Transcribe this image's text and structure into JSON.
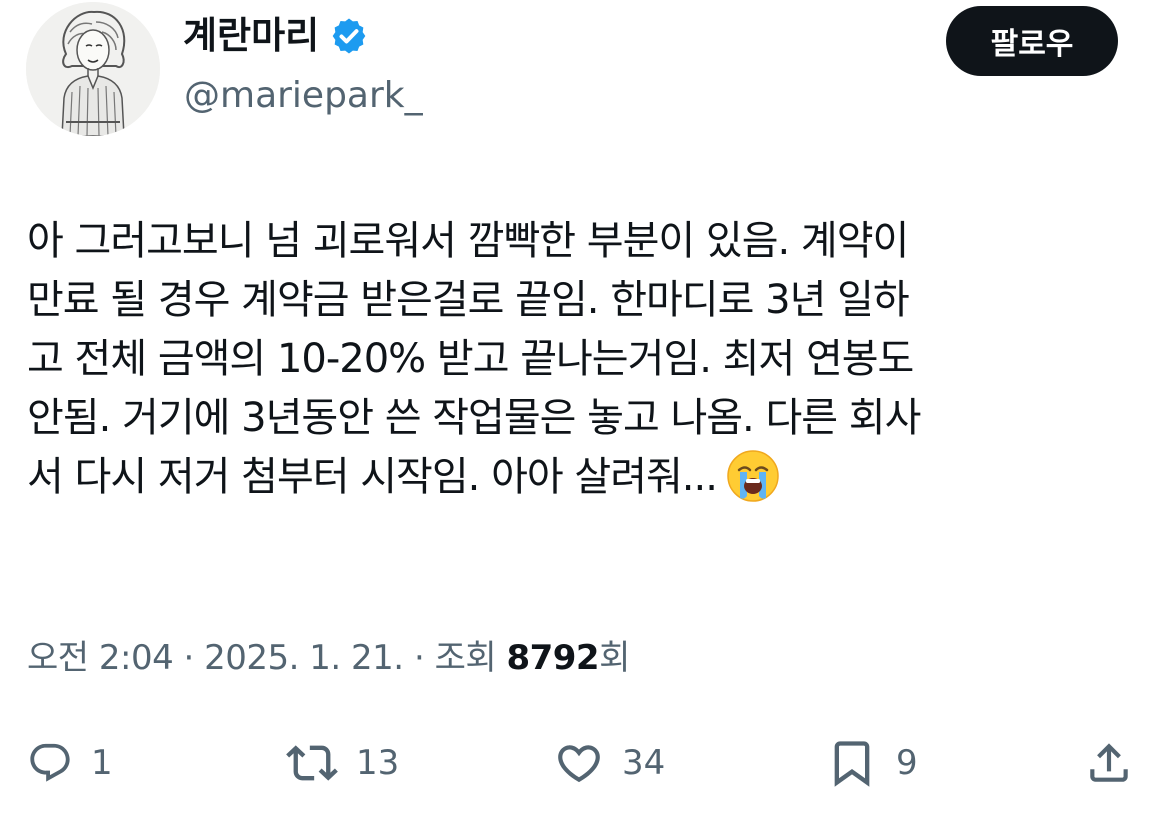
{
  "author": {
    "display_name": "계란마리",
    "handle": "@mariepark_",
    "verified": true,
    "verified_color": "#1d9bf0"
  },
  "follow_button": {
    "label": "팔로우"
  },
  "tweet": {
    "lines": [
      "아 그러고보니 넘 괴로워서 깜빡한 부분이 있음. 계약이",
      "만료 될 경우 계약금 받은걸로 끝임. 한마디로 3년 일하",
      "고 전체 금액의 10-20% 받고 끝나는거임. 최저 연봉도",
      "안됨. 거기에 3년동안 쓴 작업물은 놓고 나옴. 다른 회사",
      "서 다시 저거 첨부터 시작임. 아아 살려줘..."
    ],
    "trailing_emoji": "loudly-crying-face-icon"
  },
  "meta": {
    "time": "오전 2:04",
    "separator": "·",
    "date": "2025. 1. 21.",
    "views_label": "조회",
    "views_count": "8792",
    "views_suffix": "회"
  },
  "actions": {
    "reply": {
      "icon": "reply-icon",
      "count": "1"
    },
    "retweet": {
      "icon": "retweet-icon",
      "count": "13"
    },
    "like": {
      "icon": "heart-icon",
      "count": "34"
    },
    "bookmark": {
      "icon": "bookmark-icon",
      "count": "9"
    },
    "share": {
      "icon": "share-icon"
    }
  },
  "colors": {
    "text_primary": "#0f1419",
    "text_secondary": "#536471",
    "follow_bg": "#0f1419",
    "follow_text": "#ffffff"
  }
}
